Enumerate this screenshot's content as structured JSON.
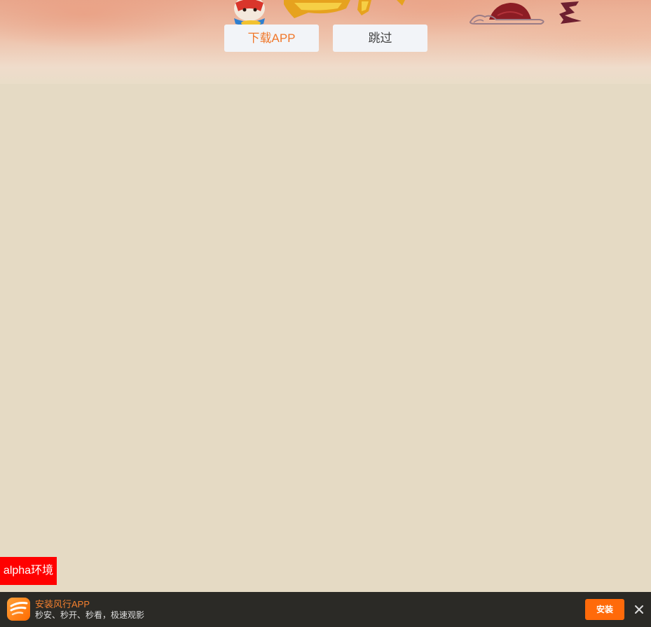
{
  "splash": {
    "download_label": "下载APP",
    "skip_label": "跳过"
  },
  "env_badge": {
    "label": "alpha环境",
    "color": "#ff0000"
  },
  "install_bar": {
    "app_name": "安装风行APP",
    "slogan": "秒安、秒开、秒看，极速观影",
    "install_label": "安装",
    "close_icon": "close-icon",
    "accent_color": "#ff6a0a"
  },
  "colors": {
    "page_background": "#e5dac4",
    "bar_background": "#2b2a26",
    "download_text": "#f0772a"
  }
}
